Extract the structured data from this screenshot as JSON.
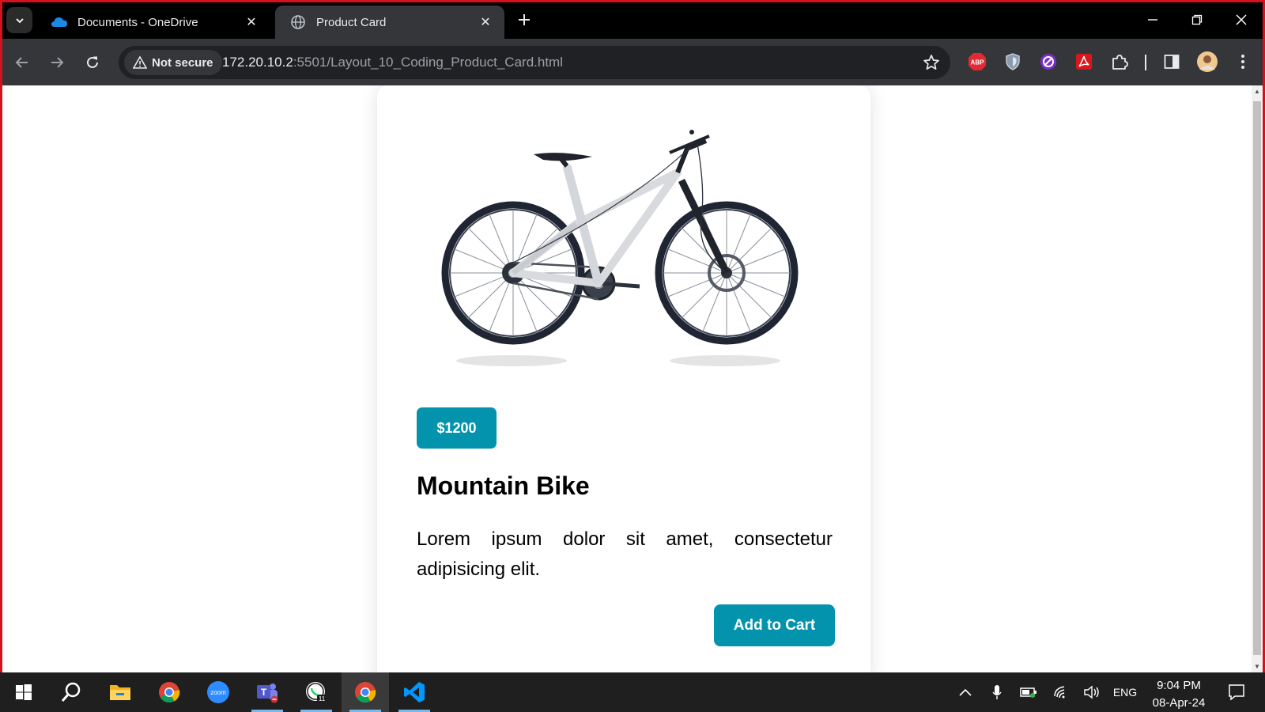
{
  "browser": {
    "tabs": [
      {
        "title": "Documents - OneDrive",
        "icon": "onedrive-icon",
        "active": false
      },
      {
        "title": "Product Card",
        "icon": "globe-icon",
        "active": true
      }
    ],
    "security_label": "Not secure",
    "url_host": "172.20.10.2",
    "url_rest": ":5501/Layout_10_Coding_Product_Card.html",
    "extensions": [
      "abp-icon",
      "shield-extension-icon",
      "privacy-extension-icon",
      "acrobat-icon",
      "puzzle-icon"
    ],
    "colors": {
      "frame": "#d4121c",
      "toolbar": "#35363a",
      "tabstrip": "#000000"
    }
  },
  "product": {
    "image": "mountain-bike-image",
    "price": "$1200",
    "name": "Mountain Bike",
    "description": "Lorem ipsum dolor sit amet, consectetur adipisicing elit.",
    "button_label": "Add to Cart",
    "accent_color": "#0493ad"
  },
  "taskbar": {
    "apps": [
      "windows-start-icon",
      "search-icon",
      "file-explorer-icon",
      "chrome-icon",
      "zoom-icon",
      "teams-icon",
      "whatsapp-icon",
      "chrome-icon",
      "vscode-icon"
    ],
    "language": "ENG",
    "time": "9:04 PM",
    "date": "08-Apr-24"
  }
}
